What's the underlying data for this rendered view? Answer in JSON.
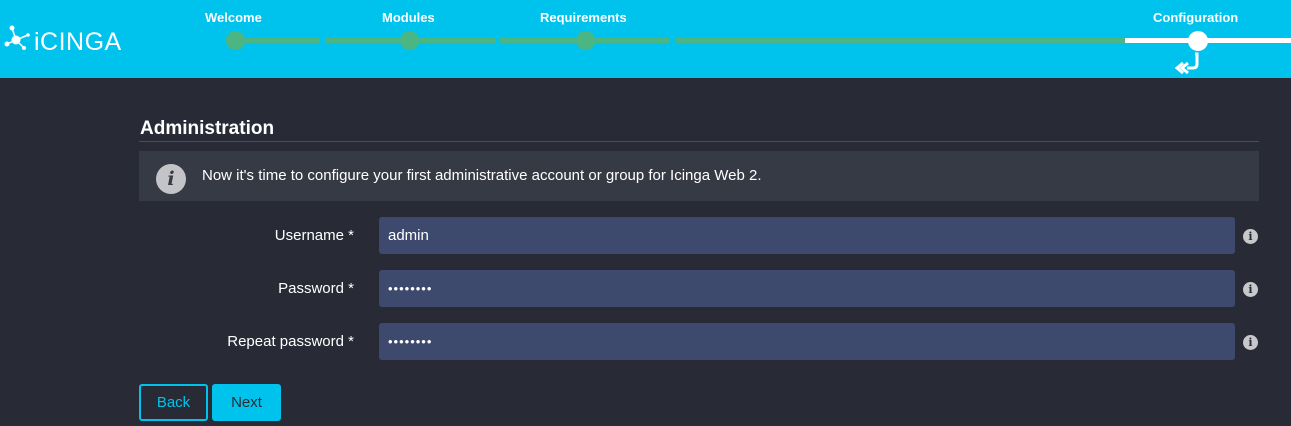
{
  "brand": {
    "name": "iCINGA",
    "accent": "#00c3ed",
    "progress_color": "#4cb584"
  },
  "wizard": {
    "steps": [
      {
        "label": "Welcome",
        "state": "done"
      },
      {
        "label": "Modules",
        "state": "done"
      },
      {
        "label": "Requirements",
        "state": "done"
      },
      {
        "label": "Configuration",
        "state": "current"
      }
    ],
    "back_icon": "double-chevron-back-icon"
  },
  "page": {
    "title": "Administration",
    "info_icon": "info-icon",
    "info_text": "Now it's time to configure your first administrative account or group for Icinga Web 2."
  },
  "form": {
    "username": {
      "label": "Username *",
      "value": "admin"
    },
    "password": {
      "label": "Password *",
      "value": "••••••••"
    },
    "repeat_password": {
      "label": "Repeat password *",
      "value": "••••••••"
    },
    "help_icon": "help-info-icon"
  },
  "buttons": {
    "back": "Back",
    "next": "Next"
  }
}
